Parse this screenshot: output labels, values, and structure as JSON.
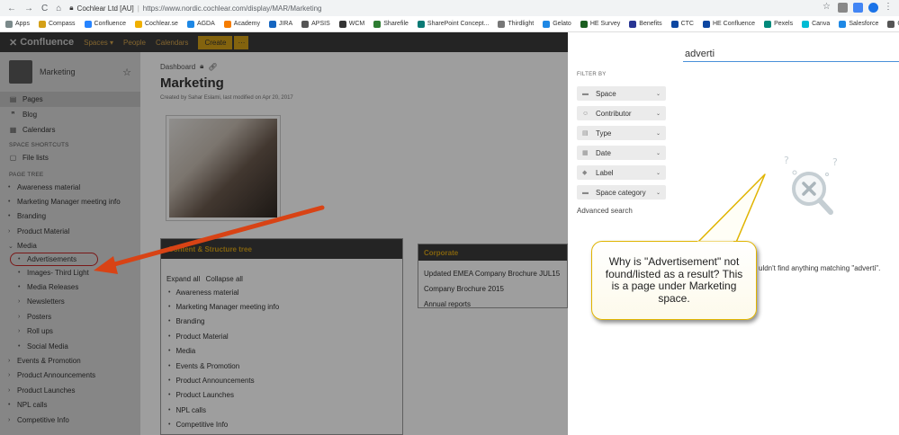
{
  "browser": {
    "site_label": "Cochlear Ltd [AU]",
    "url": "https://www.nordic.cochlear.com/display/MAR/Marketing",
    "bookmarks": [
      "Apps",
      "Compass",
      "Confluence",
      "Cochlear.se",
      "AGDA",
      "Academy",
      "JIRA",
      "APSIS",
      "WCM",
      "Sharefile",
      "SharePoint Concept...",
      "Thirdlight",
      "Gelato",
      "HE Survey",
      "Benefits",
      "CTC",
      "HE Confluence",
      "Pexels",
      "Canva",
      "Salesforce",
      "Oracle"
    ]
  },
  "header": {
    "logo": "Confluence",
    "nav": [
      "Spaces ▾",
      "People",
      "Calendars"
    ],
    "create_label": "Create",
    "more_label": "···"
  },
  "sidebar": {
    "space_name": "Marketing",
    "links": [
      {
        "icon": "pages-icon",
        "label": "Pages"
      },
      {
        "icon": "blog-icon",
        "label": "Blog"
      },
      {
        "icon": "calendar-icon",
        "label": "Calendars"
      }
    ],
    "shortcuts_heading": "SPACE SHORTCUTS",
    "shortcut": "File lists",
    "tree_heading": "PAGE TREE",
    "tree": [
      {
        "label": "Awareness material",
        "level": 0,
        "bullet": "•"
      },
      {
        "label": "Marketing Manager meeting info",
        "level": 0,
        "bullet": "•"
      },
      {
        "label": "Branding",
        "level": 0,
        "bullet": "•"
      },
      {
        "label": "Product Material",
        "level": 0,
        "bullet": "›"
      },
      {
        "label": "Media",
        "level": 0,
        "bullet": "⌄"
      },
      {
        "label": "Advertisements",
        "level": 1,
        "bullet": "•",
        "circled": true
      },
      {
        "label": "Images- Third Light",
        "level": 1,
        "bullet": "•"
      },
      {
        "label": "Media Releases",
        "level": 1,
        "bullet": "•"
      },
      {
        "label": "Newsletters",
        "level": 1,
        "bullet": "›"
      },
      {
        "label": "Posters",
        "level": 1,
        "bullet": "›"
      },
      {
        "label": "Roll ups",
        "level": 1,
        "bullet": "›"
      },
      {
        "label": "Social Media",
        "level": 1,
        "bullet": "•"
      },
      {
        "label": "Events & Promotion",
        "level": 0,
        "bullet": "›"
      },
      {
        "label": "Product Announcements",
        "level": 0,
        "bullet": "›"
      },
      {
        "label": "Product Launches",
        "level": 0,
        "bullet": "›"
      },
      {
        "label": "NPL calls",
        "level": 0,
        "bullet": "•"
      },
      {
        "label": "Competitive Info",
        "level": 0,
        "bullet": "›"
      }
    ]
  },
  "main": {
    "breadcrumb": "Dashboard",
    "title": "Marketing",
    "byline": "Created by Sahar Eslami, last modified on Apr 20, 2017",
    "structure_title": "Content & Structure tree",
    "expand_all": "Expand all",
    "collapse_all": "Collapse all",
    "structure_items": [
      "Awareness material",
      "Marketing Manager meeting info",
      "Branding",
      "Product Material",
      "Media",
      "Events & Promotion",
      "Product Announcements",
      "Product Launches",
      "NPL calls",
      "Competitive Info"
    ],
    "corporate_title": "Corporate",
    "corporate_links": [
      "Updated EMEA Company Brochure JUL15",
      "Company Brochure 2015",
      "Annual reports"
    ]
  },
  "search": {
    "query": "adverti",
    "filter_heading": "FILTER BY",
    "filters": [
      {
        "icon": "space-icon",
        "label": "Space"
      },
      {
        "icon": "contributor-icon",
        "label": "Contributor"
      },
      {
        "icon": "type-icon",
        "label": "Type"
      },
      {
        "icon": "date-icon",
        "label": "Date"
      },
      {
        "icon": "label-icon",
        "label": "Label"
      },
      {
        "icon": "space-category-icon",
        "label": "Space category"
      }
    ],
    "advanced": "Advanced search",
    "no_result": "uldn't find anything matching \"adverti\"."
  },
  "callout": {
    "text": "Why is \"Advertisement\" not found/listed as a result? This is a page under Marketing space."
  },
  "colors": {
    "header_bg": "#3b3b3b",
    "accent_yellow": "#d4a017",
    "sidebar_bg": "#d9d9d9",
    "search_underline": "#4a90d9",
    "annotation_red": "#d84315",
    "callout_border": "#e0b400"
  }
}
